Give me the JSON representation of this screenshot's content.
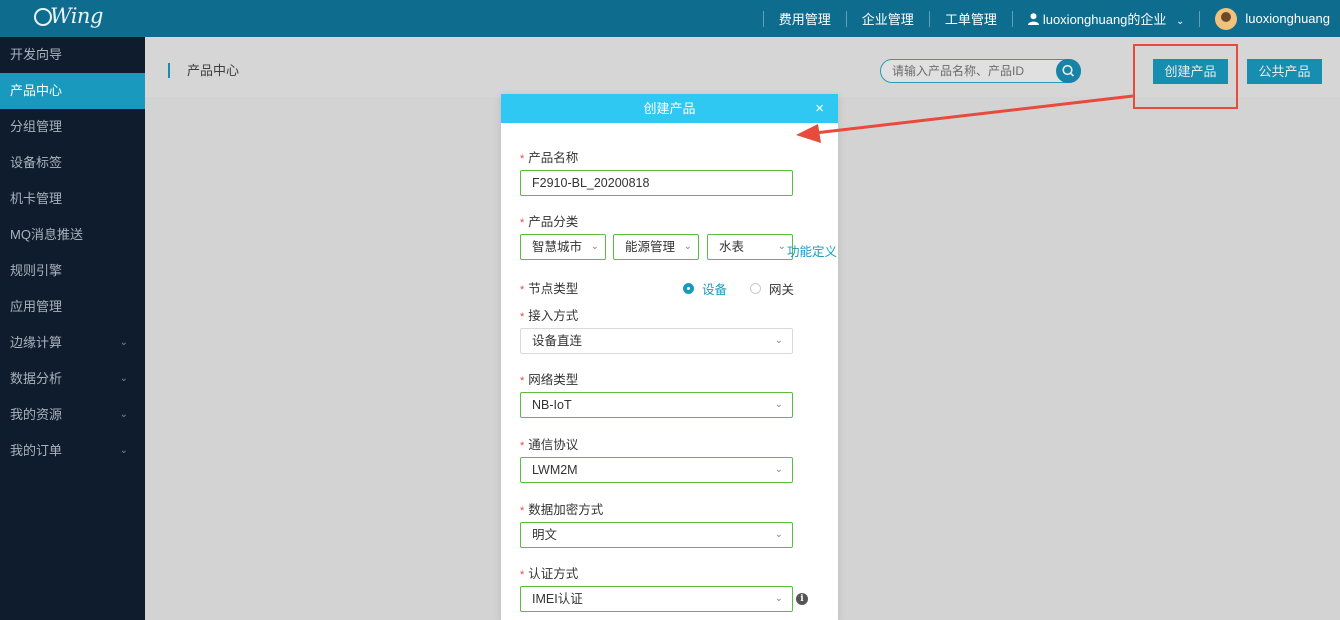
{
  "brand": {
    "logo_text": "Wing"
  },
  "topnav": {
    "items": [
      "费用管理",
      "企业管理",
      "工单管理"
    ],
    "enterprise": "luoxionghuang的企业",
    "username": "luoxionghuang"
  },
  "sidebar": {
    "items": [
      {
        "label": "开发向导",
        "expandable": false
      },
      {
        "label": "产品中心",
        "expandable": false,
        "active": true
      },
      {
        "label": "分组管理",
        "expandable": false
      },
      {
        "label": "设备标签",
        "expandable": false
      },
      {
        "label": "机卡管理",
        "expandable": false
      },
      {
        "label": "MQ消息推送",
        "expandable": false
      },
      {
        "label": "规则引擎",
        "expandable": false
      },
      {
        "label": "应用管理",
        "expandable": false
      },
      {
        "label": "边缘计算",
        "expandable": true
      },
      {
        "label": "数据分析",
        "expandable": true
      },
      {
        "label": "我的资源",
        "expandable": true
      },
      {
        "label": "我的订单",
        "expandable": true
      }
    ]
  },
  "main": {
    "breadcrumb": "产品中心",
    "search_placeholder": "请输入产品名称、产品ID",
    "create_button": "创建产品",
    "public_button": "公共产品"
  },
  "modal": {
    "title": "创建产品",
    "close": "×",
    "fields": {
      "product_name": {
        "label": "产品名称",
        "value": "F2910-BL_20200818"
      },
      "category": {
        "label": "产品分类",
        "level1": "智慧城市",
        "level2": "能源管理",
        "level3": "水表",
        "link": "功能定义"
      },
      "node_type": {
        "label": "节点类型",
        "option_device": "设备",
        "option_gateway": "网关",
        "selected": "设备"
      },
      "access_mode": {
        "label": "接入方式",
        "value": "设备直连"
      },
      "network_type": {
        "label": "网络类型",
        "value": "NB-IoT"
      },
      "protocol": {
        "label": "通信协议",
        "value": "LWM2M"
      },
      "encryption": {
        "label": "数据加密方式",
        "value": "明文"
      },
      "auth": {
        "label": "认证方式",
        "value": "IMEI认证"
      }
    },
    "required_mark": "*"
  },
  "colors": {
    "topbar": "#0e6d8f",
    "sidebar": "#0f1c2d",
    "accent": "#1a99bf",
    "modal_header": "#2ec8f2",
    "field_border": "#5dbb3f",
    "annotation": "#e84a3c"
  }
}
